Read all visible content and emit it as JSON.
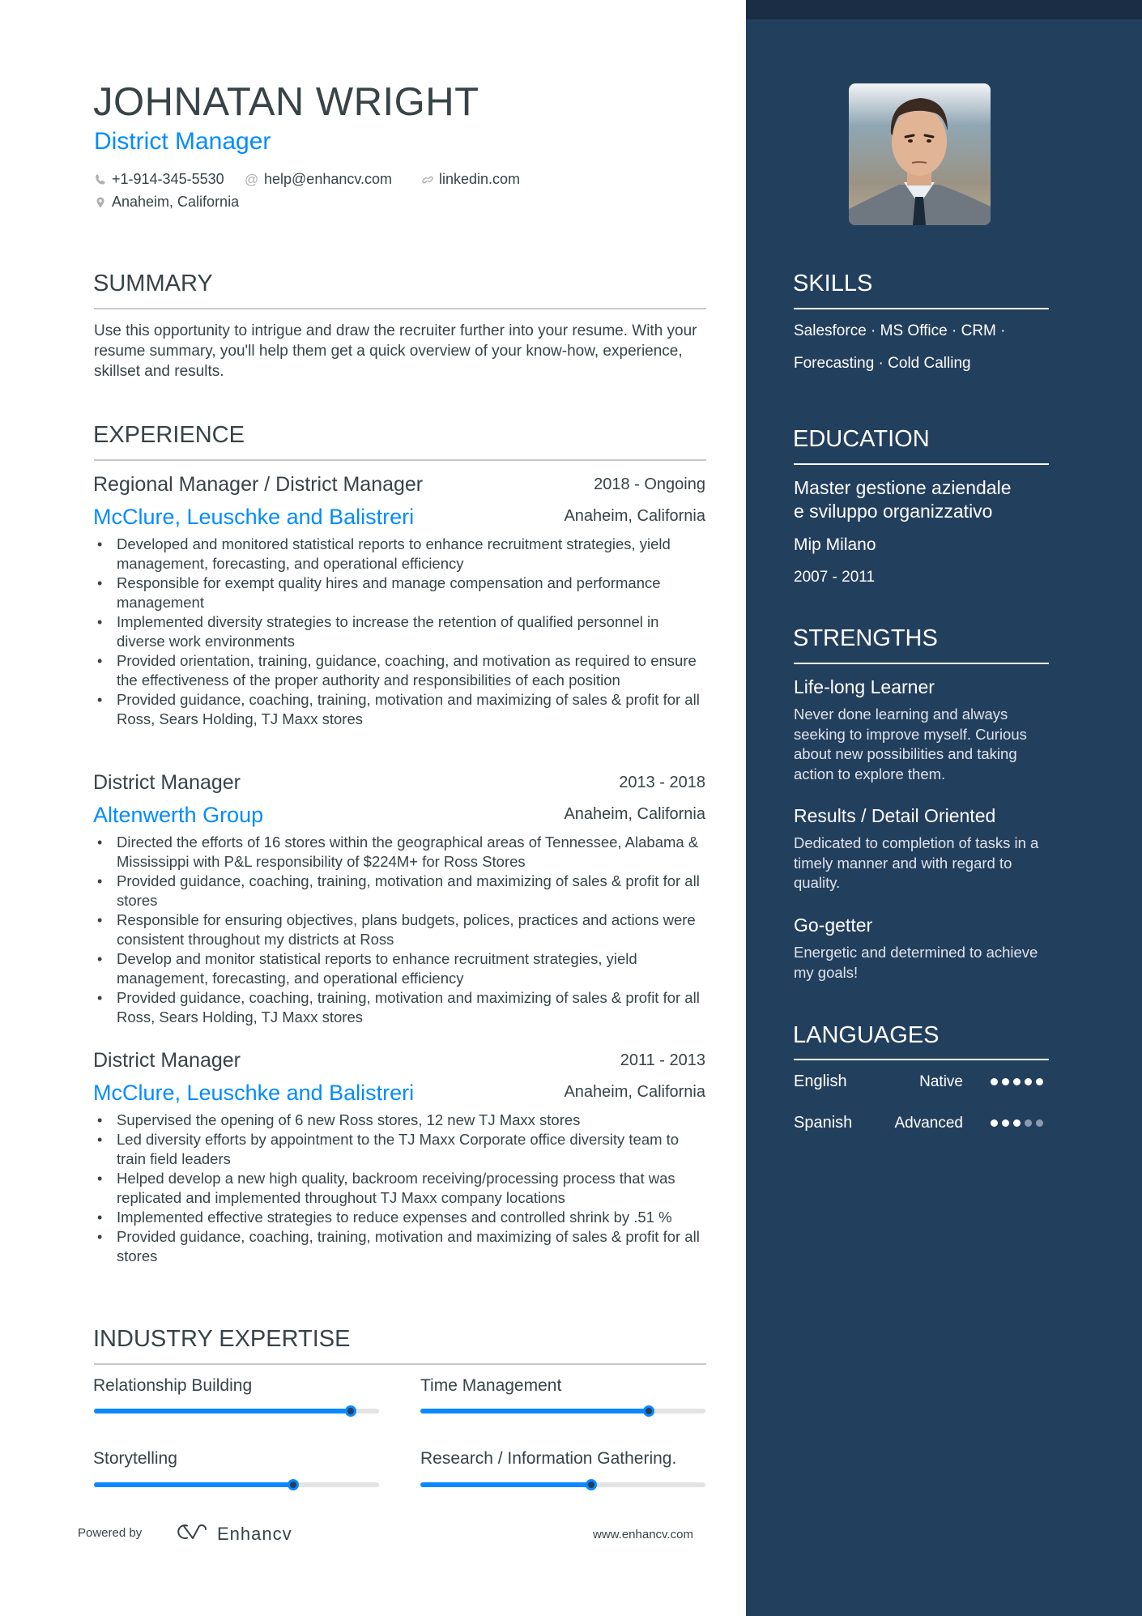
{
  "header": {
    "name": "JOHNATAN WRIGHT",
    "title": "District Manager",
    "contact": {
      "phone": "+1-914-345-5530",
      "email": "help@enhancv.com",
      "link": "linkedin.com",
      "location": "Anaheim, California"
    },
    "icons": {
      "phone": "phone-icon",
      "email": "at-icon",
      "link": "link-icon",
      "location": "map-pin-icon"
    }
  },
  "summary": {
    "title": "SUMMARY",
    "text": "Use this opportunity to intrigue and draw the recruiter further into your resume. With your resume summary, you'll help them get a quick overview of your know-how, experience, skillset and results."
  },
  "experience": {
    "title": "EXPERIENCE",
    "jobs": [
      {
        "title": "Regional Manager / District Manager",
        "dates": "2018 - Ongoing",
        "company": "McClure, Leuschke and Balistreri",
        "location": "Anaheim, California",
        "bullets": [
          "Developed and monitored statistical reports to enhance recruitment strategies, yield management, forecasting, and operational efficiency",
          "Responsible for exempt quality hires and manage compensation and performance management",
          "Implemented diversity strategies to increase the retention of qualified personnel in diverse work environments",
          "Provided orientation, training, guidance, coaching, and motivation as required to ensure the effectiveness of the proper authority and responsibilities of each position",
          "Provided guidance, coaching, training, motivation and maximizing of sales & profit for all Ross, Sears Holding, TJ Maxx stores"
        ]
      },
      {
        "title": "District Manager",
        "dates": "2013 - 2018",
        "company": "Altenwerth Group",
        "location": "Anaheim, California",
        "bullets": [
          "Directed the efforts of 16 stores within the geographical areas of Tennessee, Alabama & Mississippi with P&L responsibility of $224M+ for Ross Stores",
          "Provided guidance, coaching, training, motivation and maximizing of sales & profit for all stores",
          "Responsible for ensuring objectives, plans budgets, polices, practices and actions were consistent throughout my districts at Ross",
          "Develop and monitor statistical reports to enhance recruitment strategies, yield management, forecasting, and operational efficiency",
          "Provided guidance, coaching, training, motivation and maximizing of sales & profit for all Ross, Sears Holding, TJ Maxx stores"
        ]
      },
      {
        "title": "District Manager",
        "dates": "2011 - 2013",
        "company": "McClure, Leuschke and Balistreri",
        "location": "Anaheim, California",
        "bullets": [
          "Supervised the opening of 6 new Ross stores, 12 new TJ Maxx stores",
          "Led diversity efforts by appointment  to the TJ Maxx Corporate office diversity team to train field leaders",
          "Helped develop a new high quality, backroom receiving/processing process that was replicated and  implemented throughout TJ Maxx company locations",
          "Implemented effective strategies to reduce expenses and controlled shrink by .51 %",
          "Provided guidance, coaching, training, motivation and maximizing of sales & profit for all stores"
        ]
      }
    ]
  },
  "expertise": {
    "title": "INDUSTRY EXPERTISE",
    "items": [
      {
        "label": "Relationship Building",
        "level": 0.9
      },
      {
        "label": "Time Management",
        "level": 0.8
      },
      {
        "label": "Storytelling",
        "level": 0.7
      },
      {
        "label": "Research / Information Gathering.",
        "level": 0.6
      }
    ]
  },
  "footer": {
    "powered_by": "Powered by",
    "brand": "Enhancv",
    "url": "www.enhancv.com"
  },
  "sidebar": {
    "photo_alt": "profile-photo",
    "skills": {
      "title": "SKILLS",
      "line1": "Salesforce · MS Office · CRM ·",
      "line2": "Forecasting · Cold Calling"
    },
    "education": {
      "title": "EDUCATION",
      "degree_line1": "Master gestione aziendale",
      "degree_line2": "e sviluppo organizzativo",
      "school": "Mip Milano",
      "dates": "2007 - 2011"
    },
    "strengths": {
      "title": "STRENGTHS",
      "items": [
        {
          "title": "Life-long Learner",
          "desc": "Never done learning and always seeking to improve myself. Curious about new possibilities and taking action to explore them."
        },
        {
          "title": "Results / Detail Oriented",
          "desc": "Dedicated to completion of tasks in a timely manner and with regard to quality."
        },
        {
          "title": "Go-getter",
          "desc": "Energetic and determined to achieve my goals!"
        }
      ]
    },
    "languages": {
      "title": "LANGUAGES",
      "items": [
        {
          "name": "English",
          "level": "Native",
          "dots": 5,
          "max": 5
        },
        {
          "name": "Spanish",
          "level": "Advanced",
          "dots": 3,
          "max": 5
        }
      ]
    }
  },
  "colors": {
    "accent": "#008cff",
    "sidebar": "#233f5e",
    "text": "#384347"
  }
}
